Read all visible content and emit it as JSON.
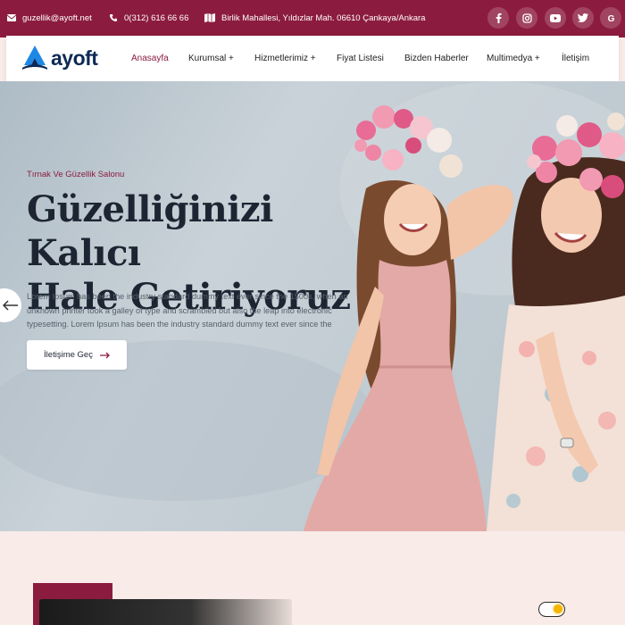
{
  "topbar": {
    "email": "guzellik@ayoft.net",
    "phone": "0(312) 616 66 66",
    "address": "Birlik Mahallesi, Yıldızlar Mah. 06610 Çankaya/Ankara",
    "social": [
      "facebook-icon",
      "instagram-icon",
      "youtube-icon",
      "twitter-icon",
      "google-icon"
    ]
  },
  "logo": {
    "text": "ayoft"
  },
  "nav": {
    "items": [
      {
        "label": "Anasayfa",
        "active": true
      },
      {
        "label": "Kurumsal +"
      },
      {
        "label": "Hizmetlerimiz +"
      },
      {
        "label": "Fiyat Listesi"
      },
      {
        "label": "Bizden Haberler"
      },
      {
        "label": "Multimedya +"
      },
      {
        "label": "İletişim"
      }
    ]
  },
  "hero": {
    "subtitle": "Tırnak Ve Güzellik Salonu",
    "headline_line1": "Güzelliğinizi Kalıcı",
    "headline_line2": "Hale Getiriyoruz",
    "paragraph": "Lorem Ipsum has been the industry standard dummy text ever since the 1500s, when an unknown printer took a galley of type and scrambled but also the leap into electronic typesetting. Lorem Ipsum has been the industry standard dummy text ever since the",
    "cta_label": "İletişime Geç"
  },
  "colors": {
    "brand": "#8c1c3f",
    "navy": "#0e2a55",
    "logo_blue": "#1e88e5",
    "toggle_knob": "#f5b400"
  }
}
